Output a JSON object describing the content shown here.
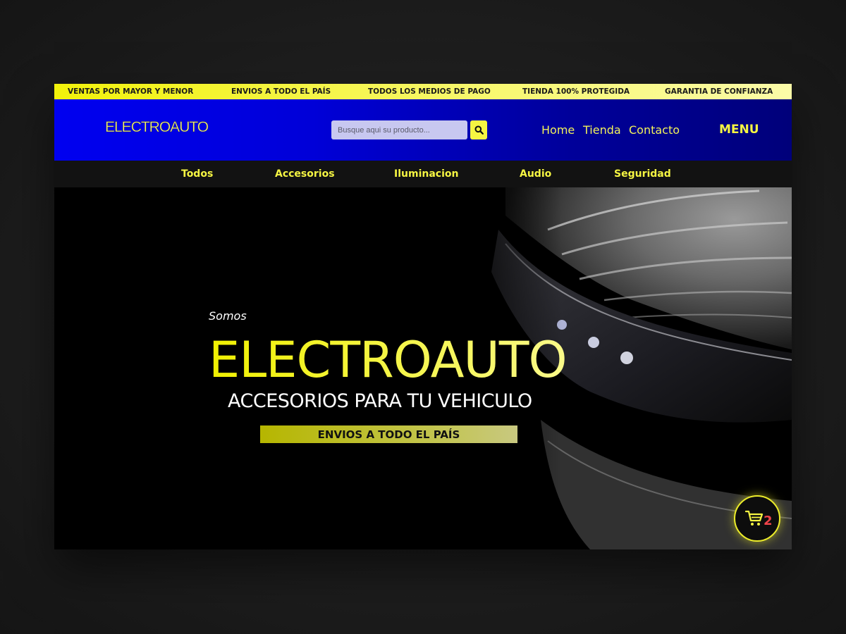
{
  "topbar": {
    "items": [
      "VENTAS POR MAYOR Y MENOR",
      "ENVIOS A TODO EL PAÍS",
      "TODOS LOS MEDIOS DE PAGO",
      "TIENDA 100% PROTEGIDA",
      "GARANTIA DE CONFIANZA"
    ]
  },
  "header": {
    "logo": "ELECTROAUTO",
    "search_placeholder": "Busque aqui su producto...",
    "search_icon": "search-icon",
    "nav": [
      "Home",
      "Tienda",
      "Contacto"
    ],
    "menu_label": "MENU"
  },
  "categories": [
    "Todos",
    "Accesorios",
    "Iluminacion",
    "Audio",
    "Seguridad"
  ],
  "hero": {
    "kicker": "Somos",
    "title": "ELECTROAUTO",
    "subtitle": "ACCESORIOS PARA TU VEHICULO",
    "ribbon": "ENVIOS A TODO EL PAÍS"
  },
  "cart": {
    "icon": "cart-icon",
    "count": "2"
  },
  "colors": {
    "accent_yellow": "#f5f542",
    "header_blue": "#0000e0",
    "cart_badge": "#f0444a"
  }
}
